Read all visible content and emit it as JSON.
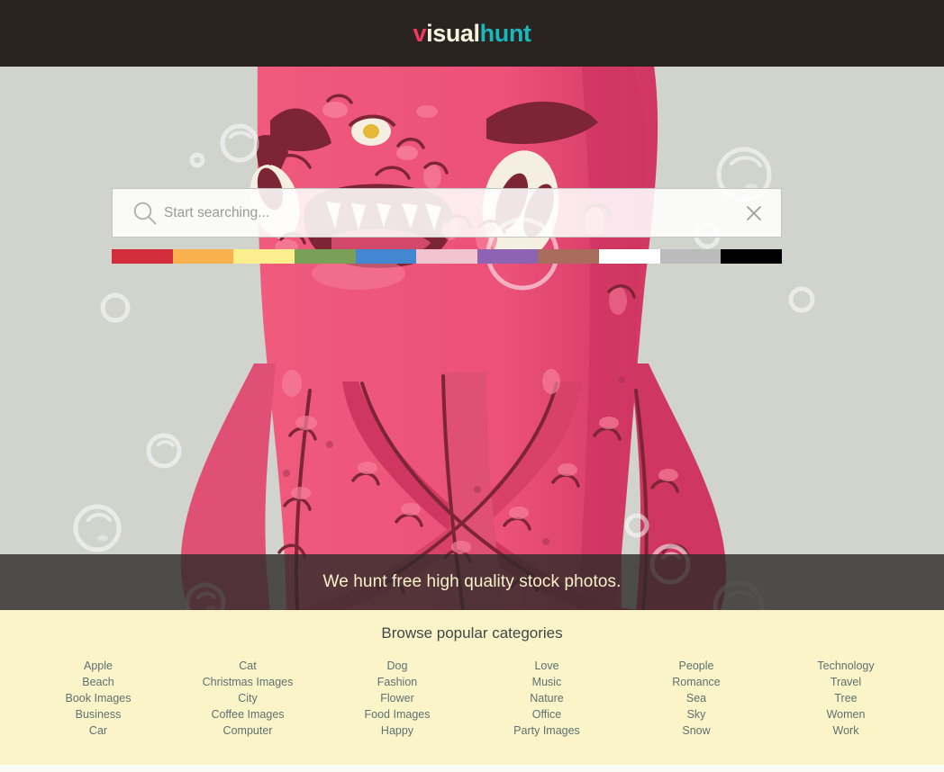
{
  "header": {
    "logo": {
      "part1": "v",
      "part2": "isual",
      "part3": "hunt"
    },
    "bg_color": "#2b2320",
    "colors": {
      "v": "#f4385b",
      "isual": "#f7f2de",
      "hunt": "#18b8bd"
    }
  },
  "hero": {
    "bg_color": "#d1d3cd",
    "illustration": "pink-monster-illustration"
  },
  "search": {
    "placeholder": "Start searching...",
    "value": "",
    "search_icon": "search-icon",
    "clear_icon": "close-icon"
  },
  "color_filters": [
    {
      "name": "red",
      "hex": "#d32c3a"
    },
    {
      "name": "orange",
      "hex": "#f9b04e"
    },
    {
      "name": "yellow",
      "hex": "#fbee8d"
    },
    {
      "name": "green",
      "hex": "#7a9f56"
    },
    {
      "name": "blue",
      "hex": "#4287d0"
    },
    {
      "name": "pink",
      "hex": "#f0c3cf"
    },
    {
      "name": "purple",
      "hex": "#8d64b4"
    },
    {
      "name": "brown",
      "hex": "#a96d5e"
    },
    {
      "name": "white",
      "hex": "#ffffff"
    },
    {
      "name": "gray",
      "hex": "#bbbbbb"
    },
    {
      "name": "black",
      "hex": "#000000"
    }
  ],
  "tagline": {
    "text": "We hunt free high quality stock photos.",
    "band_color": "#2d2b29",
    "text_color": "#fbf2c8"
  },
  "categories": {
    "heading": "Browse popular categories",
    "bg_color": "#fbf4c8",
    "link_color": "#5d7171",
    "columns": [
      {
        "items": [
          "Apple",
          "Beach",
          "Book Images",
          "Business",
          "Car"
        ]
      },
      {
        "items": [
          "Cat",
          "Christmas Images",
          "City",
          "Coffee Images",
          "Computer"
        ]
      },
      {
        "items": [
          "Dog",
          "Fashion",
          "Flower",
          "Food Images",
          "Happy"
        ]
      },
      {
        "items": [
          "Love",
          "Music",
          "Nature",
          "Office",
          "Party Images"
        ]
      },
      {
        "items": [
          "People",
          "Romance",
          "Sea",
          "Sky",
          "Snow"
        ]
      },
      {
        "items": [
          "Technology",
          "Travel",
          "Tree",
          "Women",
          "Work"
        ]
      }
    ]
  }
}
